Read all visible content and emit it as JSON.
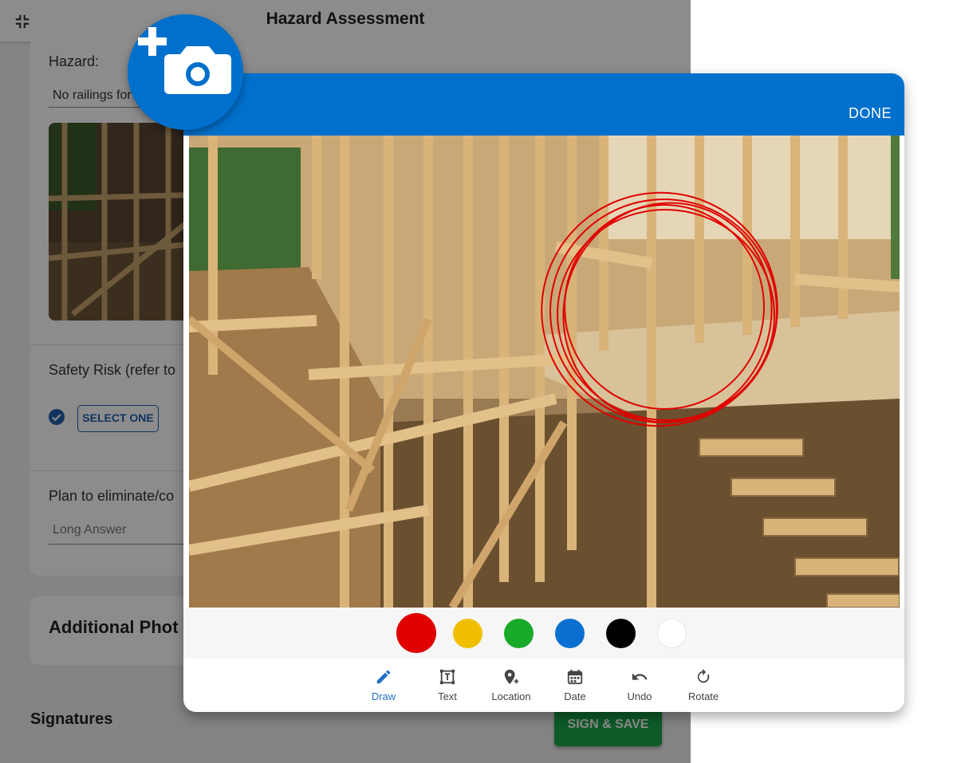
{
  "app": {
    "title": "Hazard Assessment",
    "icons": {
      "collapse": "collapse-icon",
      "check": "check-circle-icon"
    }
  },
  "form": {
    "hazard_label": "Hazard:",
    "hazard_value": "No railings for",
    "safety_risk_label": "Safety Risk (refer to",
    "select_one_label": "SELECT ONE",
    "plan_label": "Plan to eliminate/co",
    "plan_placeholder": "Long Answer"
  },
  "additional_photos": {
    "title": "Additional Phot"
  },
  "signatures": {
    "label": "Signatures",
    "sign_save_label": "SIGN & SAVE"
  },
  "editor": {
    "done_label": "DONE",
    "colors": [
      {
        "name": "red",
        "hex": "#e00000",
        "selected": true
      },
      {
        "name": "yellow",
        "hex": "#f0c000",
        "selected": false
      },
      {
        "name": "green",
        "hex": "#1aaa2a",
        "selected": false
      },
      {
        "name": "blue",
        "hex": "#0a6fd0",
        "selected": false
      },
      {
        "name": "black",
        "hex": "#000000",
        "selected": false
      },
      {
        "name": "white",
        "hex": "#ffffff",
        "selected": false
      }
    ],
    "tools": [
      {
        "label": "Draw",
        "icon": "pencil-icon",
        "active": true
      },
      {
        "label": "Text",
        "icon": "text-box-icon",
        "active": false
      },
      {
        "label": "Location",
        "icon": "location-plus-icon",
        "active": false
      },
      {
        "label": "Date",
        "icon": "calendar-icon",
        "active": false
      },
      {
        "label": "Undo",
        "icon": "undo-icon",
        "active": false
      },
      {
        "label": "Rotate",
        "icon": "rotate-icon",
        "active": false
      }
    ]
  },
  "camera_fab": {
    "icon": "add-camera-icon"
  },
  "theme": {
    "primary": "#0070cc",
    "success": "#1aa64a",
    "annotation": "#e00000"
  }
}
